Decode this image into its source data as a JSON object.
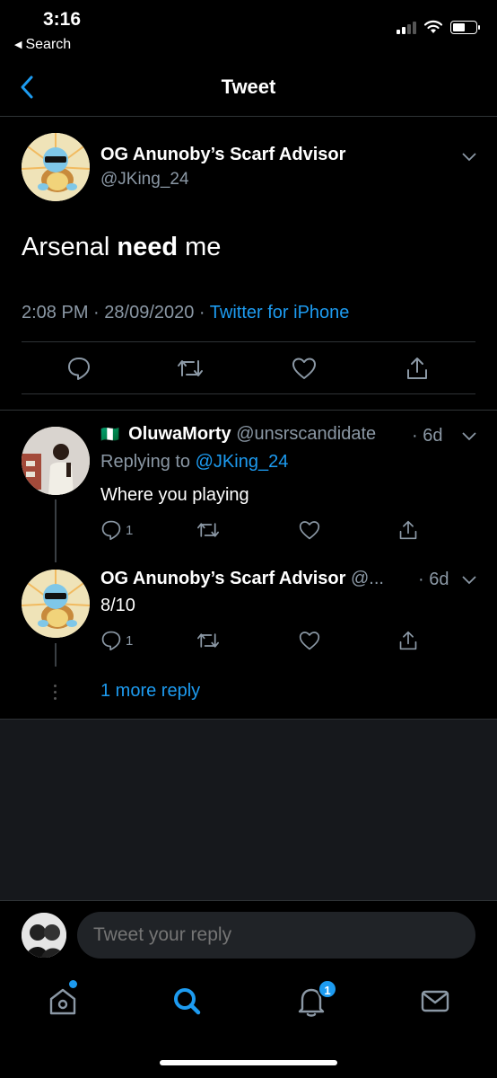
{
  "status": {
    "time": "3:16",
    "back_label": "Search"
  },
  "nav": {
    "title": "Tweet"
  },
  "tweet": {
    "author_name": "OG Anunoby’s Scarf Advisor",
    "author_handle": "@JKing_24",
    "text_part1": "Arsenal ",
    "text_bold": "need",
    "text_part2": " me",
    "time": "2:08 PM",
    "date": "28/09/2020",
    "separator": " · ",
    "client": "Twitter for iPhone"
  },
  "replies": [
    {
      "flag": "🇳🇬",
      "name": "OluwaMorty",
      "handle": "@unsrscandidate",
      "time": "· 6d",
      "replying_prefix": "Replying to ",
      "replying_to": "@JKing_24",
      "text": "Where you playing",
      "reply_count": "1"
    },
    {
      "name": "OG Anunoby’s Scarf Advisor",
      "handle": "@...",
      "time": "· 6d",
      "text": "8/10",
      "reply_count": "1"
    }
  ],
  "more_reply": "1 more reply",
  "composer": {
    "placeholder": "Tweet your reply"
  },
  "tabbar": {
    "notifications_badge": "1"
  },
  "colors": {
    "accent": "#1d9bf0",
    "muted": "#8b98a5",
    "background": "#000000",
    "divider": "#2f3336"
  }
}
